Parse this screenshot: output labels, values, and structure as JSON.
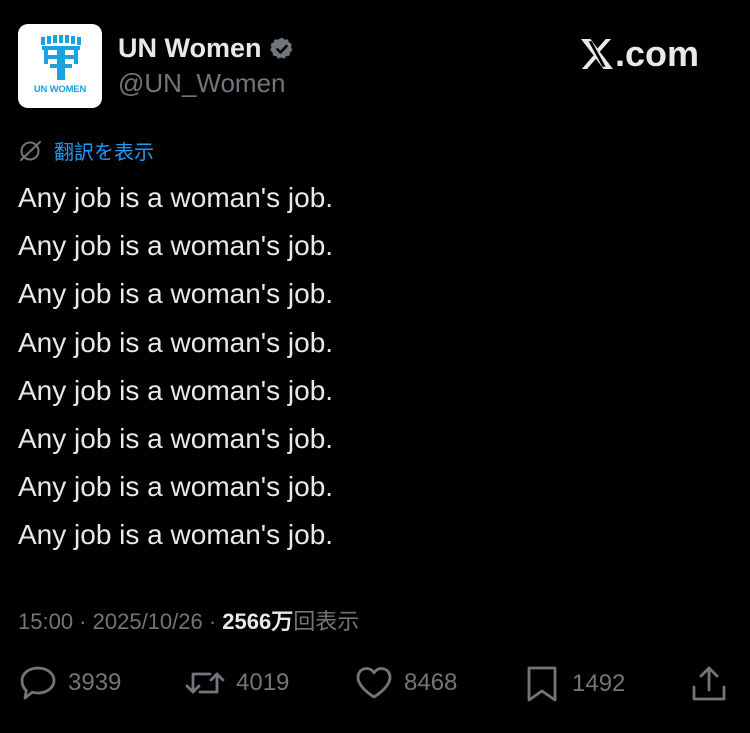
{
  "author": {
    "logo_text": "UN WOMEN",
    "display_name": "UN Women",
    "handle": "@UN_Women",
    "verified": true
  },
  "brand": {
    "label": ".com"
  },
  "translate": {
    "label": "翻訳を表示"
  },
  "tweet": {
    "lines": [
      "Any job is a woman's job.",
      "Any job is a woman's job.",
      "Any job is a woman's job.",
      "Any job is a woman's job.",
      "Any job is a woman's job.",
      "Any job is a woman's job.",
      "Any job is a woman's job.",
      "Any job is a woman's job."
    ]
  },
  "meta": {
    "time": "15:00",
    "sep1": " · ",
    "date": "2025/10/26",
    "sep2": " · ",
    "views_count": "2566万",
    "views_label": "回表示"
  },
  "actions": {
    "replies": "3939",
    "reposts": "4019",
    "likes": "8468",
    "bookmarks": "1492"
  },
  "colors": {
    "background": "#000000",
    "text_primary": "#e7e9ea",
    "text_secondary": "#71767b",
    "link_blue": "#1d9bf0",
    "logo_blue": "#1aa3dd"
  }
}
